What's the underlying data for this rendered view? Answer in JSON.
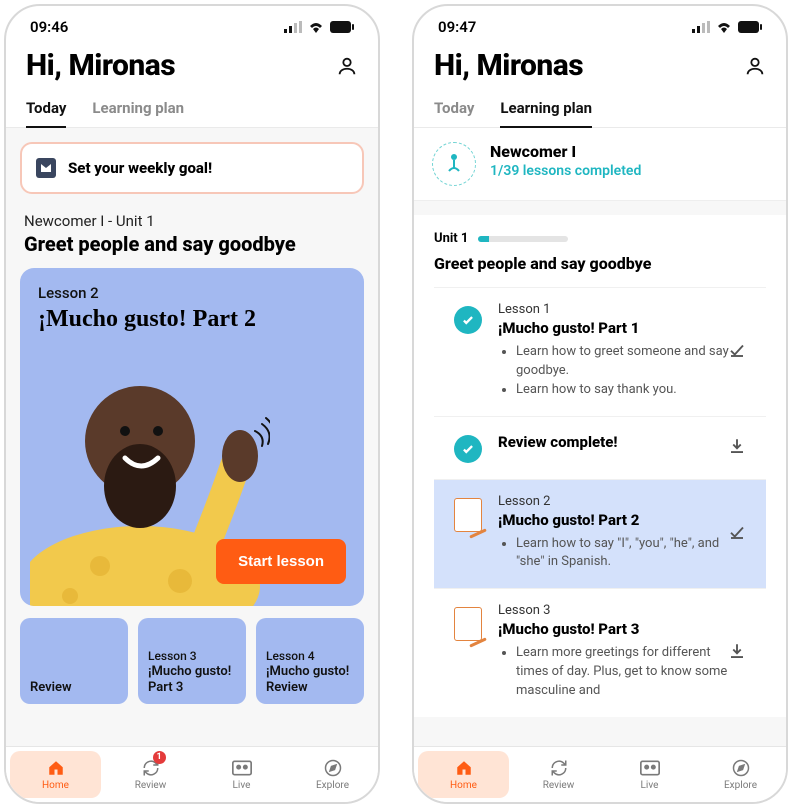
{
  "phone1": {
    "time": "09:46",
    "greeting": "Hi, Mironas",
    "tabs": {
      "today": "Today",
      "plan": "Learning plan"
    },
    "goal_text": "Set your weekly goal!",
    "unit_label": "Newcomer I  - Unit 1",
    "unit_title": "Greet people and say goodbye",
    "lesson_current": {
      "label": "Lesson 2",
      "title": "¡Mucho gusto! Part 2"
    },
    "start_lesson": "Start lesson",
    "mini": [
      {
        "label": "",
        "title": "Review"
      },
      {
        "label": "Lesson 3",
        "title": "¡Mucho gusto! Part 3"
      },
      {
        "label": "Lesson 4",
        "title": "¡Mucho gusto! Review"
      }
    ],
    "nav": {
      "home": "Home",
      "review": "Review",
      "review_badge": "1",
      "live": "Live",
      "explore": "Explore"
    }
  },
  "phone2": {
    "time": "09:47",
    "greeting": "Hi, Mironas",
    "tabs": {
      "today": "Today",
      "plan": "Learning plan"
    },
    "course": {
      "name": "Newcomer I",
      "sub": "1/39 lessons completed"
    },
    "unit": {
      "label": "Unit 1",
      "progress_pct": 12,
      "title": "Greet people and say goodbye"
    },
    "lessons": [
      {
        "label": "Lesson 1",
        "title": "¡Mucho gusto! Part 1",
        "bullets": [
          "Learn how to greet someone and say goodbye.",
          "Learn how to say thank you."
        ],
        "status": "done"
      },
      {
        "label": "",
        "title": "Review complete!",
        "bullets": [],
        "status": "review-done"
      },
      {
        "label": "Lesson 2",
        "title": "¡Mucho gusto! Part 2",
        "bullets": [
          "Learn how to say \"I\", \"you\", \"he\", and \"she\" in Spanish."
        ],
        "status": "current"
      },
      {
        "label": "Lesson 3",
        "title": "¡Mucho gusto! Part 3",
        "bullets": [
          "Learn more greetings for different times of day. Plus, get to know some masculine and"
        ],
        "status": "next"
      }
    ],
    "nav": {
      "home": "Home",
      "review": "Review",
      "live": "Live",
      "explore": "Explore"
    }
  }
}
